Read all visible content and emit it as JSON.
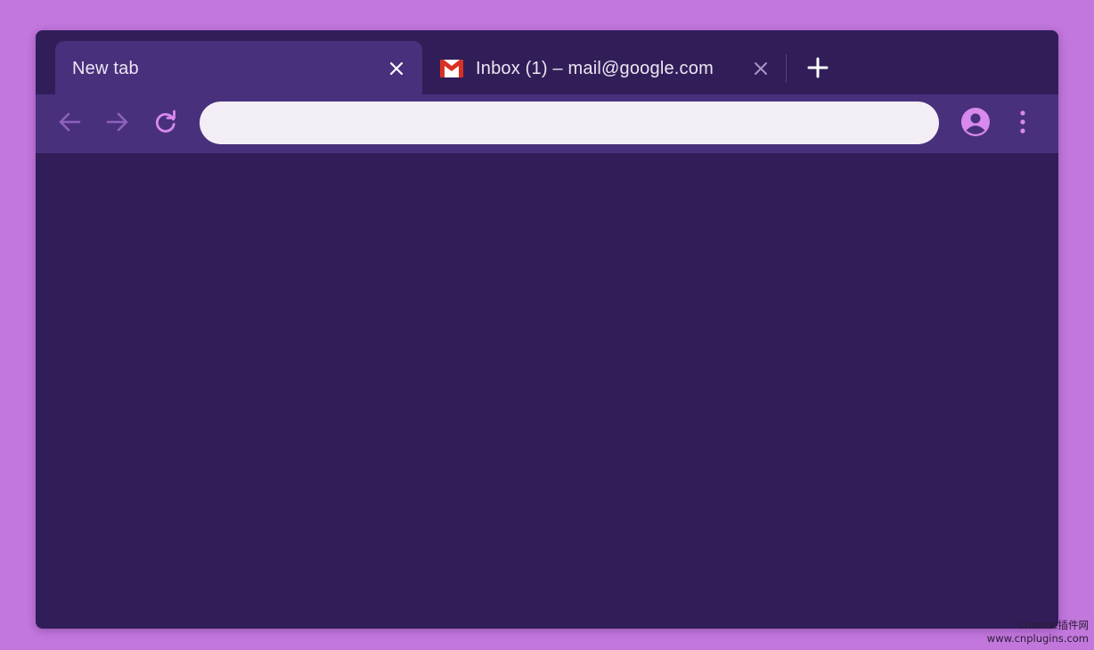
{
  "tabs": [
    {
      "label": "New tab",
      "active": true,
      "close_icon": "close-icon"
    },
    {
      "label": "Inbox (1) – mail@google.com",
      "active": false,
      "favicon": "gmail-icon",
      "close_icon": "close-icon"
    }
  ],
  "new_tab_icon": "plus-icon",
  "toolbar": {
    "back_icon": "arrow-left-icon",
    "forward_icon": "arrow-right-icon",
    "reload_icon": "reload-icon",
    "omnibox": {
      "value": "",
      "placeholder": ""
    },
    "profile_icon": "account-circle-icon",
    "menu_icon": "more-vert-icon"
  },
  "colors": {
    "page_background": "#c277dd",
    "frame": "#311e59",
    "active_tab_and_toolbar": "#48307c",
    "omnibox": "#f3eef6",
    "icon_accent": "#d889ee"
  },
  "watermark": {
    "line1": "Chrome插件网",
    "line2": "www.cnplugins.com"
  }
}
